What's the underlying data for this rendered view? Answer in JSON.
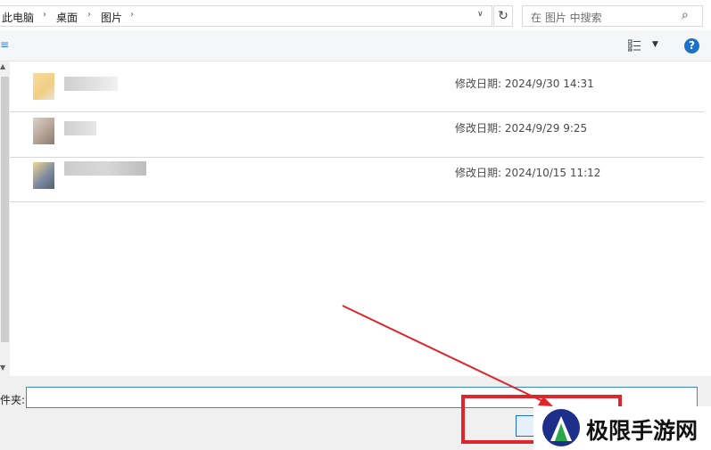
{
  "breadcrumb": [
    "此电脑",
    "桌面",
    "图片"
  ],
  "search": {
    "placeholder": "在 图片 中搜索"
  },
  "toolbar": {
    "left_glyph": "≡",
    "help_label": "?"
  },
  "files": [
    {
      "date": "修改日期: 2024/9/30 14:31"
    },
    {
      "date": "修改日期: 2024/9/29 9:25"
    },
    {
      "date": "修改日期: 2024/10/15 11:12"
    }
  ],
  "footer": {
    "folder_label": "件夹:",
    "folder_value": ""
  },
  "watermark": {
    "text": "极限手游网"
  },
  "colors": {
    "accent": "#1a73c9",
    "highlight_red": "#e0262a",
    "folder_input_border": "#3b86d0"
  }
}
